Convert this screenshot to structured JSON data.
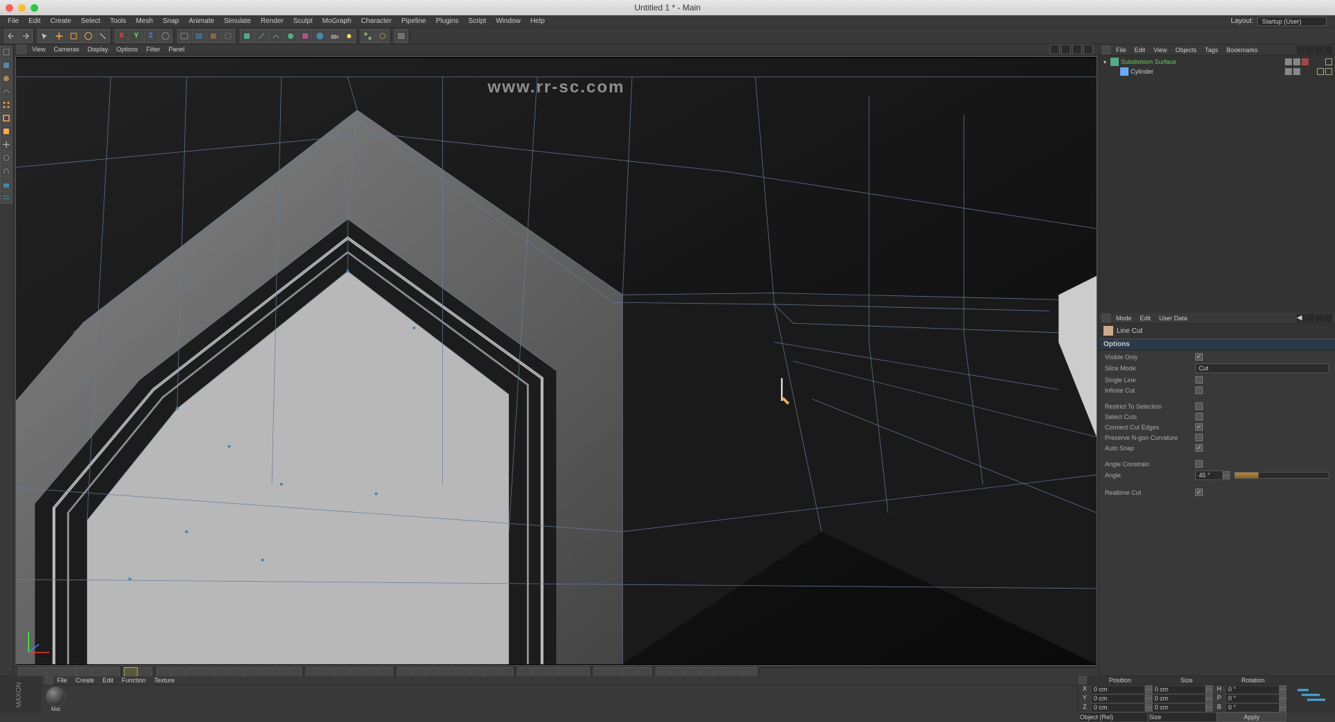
{
  "titlebar": {
    "title": "Untitled 1 * - Main"
  },
  "watermark_url": "www.rr-sc.com",
  "menubar": {
    "items": [
      "File",
      "Edit",
      "Create",
      "Select",
      "Tools",
      "Mesh",
      "Snap",
      "Animate",
      "Simulate",
      "Render",
      "Sculpt",
      "MoGraph",
      "Character",
      "Pipeline",
      "Plugins",
      "Script",
      "Window",
      "Help"
    ],
    "layout_label": "Layout:",
    "layout_value": "Startup (User)"
  },
  "viewport_menu": [
    "View",
    "Cameras",
    "Display",
    "Options",
    "Filter",
    "Panel"
  ],
  "object_manager": {
    "menu": [
      "File",
      "Edit",
      "View",
      "Objects",
      "Tags",
      "Bookmarks"
    ],
    "items": [
      {
        "name": "Subdivision Surface",
        "color": "green",
        "indent": 0,
        "has_x": true
      },
      {
        "name": "Cylinder",
        "color": "normal",
        "indent": 1,
        "has_x": false
      }
    ]
  },
  "attribute_manager": {
    "menu": [
      "Mode",
      "Edit",
      "User Data"
    ],
    "tool_name": "Line Cut",
    "sections": {
      "options_label": "Options",
      "options": [
        {
          "label": "Visible Only",
          "type": "checkbox",
          "checked": true
        },
        {
          "label": "Slice Mode",
          "type": "select",
          "value": "Cut"
        },
        {
          "label": "Single Line",
          "type": "checkbox",
          "checked": false
        },
        {
          "label": "Infinite Cut",
          "type": "checkbox",
          "checked": false
        },
        {
          "label": "Restrict To Selection",
          "type": "checkbox",
          "checked": false
        },
        {
          "label": "Select Cuts",
          "type": "checkbox",
          "checked": false
        },
        {
          "label": "Connect Cut Edges",
          "type": "checkbox",
          "checked": true
        },
        {
          "label": "Preserve N-gon Curvature",
          "type": "checkbox",
          "checked": false
        },
        {
          "label": "Auto Snap",
          "type": "checkbox",
          "checked": true
        },
        {
          "label": "Angle Constrain",
          "type": "checkbox",
          "checked": false
        },
        {
          "label": "Angle",
          "type": "slider",
          "value": "45 °",
          "fill": 25
        },
        {
          "label": "Realtime Cut",
          "type": "checkbox",
          "checked": true
        }
      ]
    }
  },
  "coordinates": {
    "headers": {
      "pos": "Position",
      "size": "Size",
      "rot": "Rotation"
    },
    "rows": [
      {
        "axis": "X",
        "pos": "0 cm",
        "size": "0 cm",
        "rot_axis": "H",
        "rot": "0 °"
      },
      {
        "axis": "Y",
        "pos": "0 cm",
        "size": "0 cm",
        "rot_axis": "P",
        "rot": "0 °"
      },
      {
        "axis": "Z",
        "pos": "0 cm",
        "size": "0 cm",
        "rot_axis": "B",
        "rot": "0 °"
      }
    ],
    "mode_select": "Object (Rel)",
    "size_select": "Size",
    "apply": "Apply"
  },
  "material_manager": {
    "menu": [
      "File",
      "Create",
      "Edit",
      "Function",
      "Texture"
    ],
    "materials": [
      {
        "name": "Mat"
      }
    ]
  }
}
